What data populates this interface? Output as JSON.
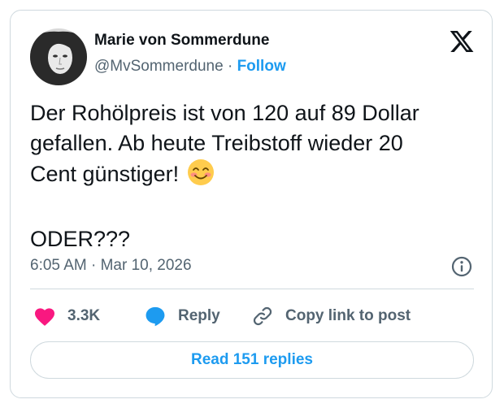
{
  "author": {
    "name": "Marie von Sommerdune",
    "handle": "@MvSommerdune",
    "separator": "·",
    "follow_label": "Follow"
  },
  "tweet": {
    "lines": [
      "Der Rohölpreis ist von 120 auf 89 Dollar",
      "gefallen. Ab heute Treibstoff wieder 20",
      "Cent günstiger!",
      "ODER???"
    ],
    "emoji": "smiling-face-with-smiling-eyes",
    "timestamp": "6:05 AM · Mar 10, 2026"
  },
  "actions": {
    "likes": "3.3K",
    "reply_label": "Reply",
    "copy_label": "Copy link to post"
  },
  "read_replies_label": "Read 151 replies",
  "colors": {
    "accent": "#1d9bf0",
    "heart": "#f91880",
    "text": "#0f1419",
    "muted": "#536471",
    "border": "#cfd9de"
  },
  "icons": [
    "x-logo-icon",
    "info-icon",
    "heart-icon",
    "reply-bubble-icon",
    "link-icon",
    "emoji-icon"
  ]
}
